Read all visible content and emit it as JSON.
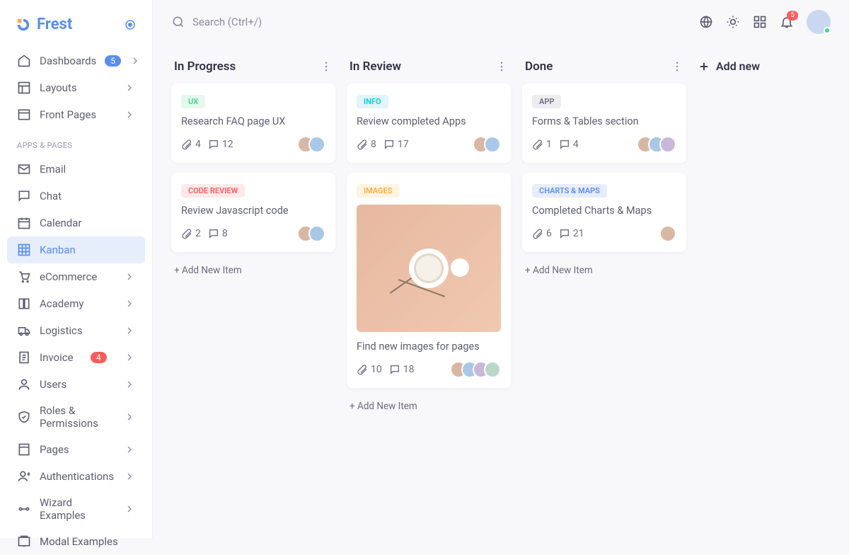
{
  "brand": "Frest",
  "search": {
    "placeholder": "Search (Ctrl+/)"
  },
  "topbar": {
    "bell_count": "5"
  },
  "sidebar": {
    "section_label": "APPS & PAGES",
    "items": [
      {
        "label": "Dashboards",
        "badge": "5",
        "chev": true
      },
      {
        "label": "Layouts",
        "chev": true
      },
      {
        "label": "Front Pages",
        "chev": true
      }
    ],
    "apps": [
      {
        "label": "Email"
      },
      {
        "label": "Chat"
      },
      {
        "label": "Calendar"
      },
      {
        "label": "Kanban",
        "active": true
      },
      {
        "label": "eCommerce",
        "chev": true
      },
      {
        "label": "Academy",
        "chev": true
      },
      {
        "label": "Logistics",
        "chev": true
      },
      {
        "label": "Invoice",
        "badge": "4",
        "badge_red": true,
        "chev": true
      },
      {
        "label": "Users",
        "chev": true
      },
      {
        "label": "Roles & Permissions",
        "chev": true
      },
      {
        "label": "Pages",
        "chev": true
      },
      {
        "label": "Authentications",
        "chev": true
      },
      {
        "label": "Wizard Examples",
        "chev": true
      },
      {
        "label": "Modal Examples"
      }
    ]
  },
  "board": {
    "add_new_label": "Add new",
    "add_item_label": "+ Add New Item",
    "columns": [
      {
        "title": "In Progress",
        "cards": [
          {
            "tag": "UX",
            "tag_class": "tag-ux",
            "title": "Research FAQ page UX",
            "attachments": "4",
            "comments": "12",
            "avatars": 2
          },
          {
            "tag": "CODE REVIEW",
            "tag_class": "tag-code",
            "title": "Review Javascript code",
            "attachments": "2",
            "comments": "8",
            "avatars": 2
          }
        ]
      },
      {
        "title": "In Review",
        "cards": [
          {
            "tag": "INFO",
            "tag_class": "tag-info",
            "title": "Review completed Apps",
            "attachments": "8",
            "comments": "17",
            "avatars": 2
          },
          {
            "tag": "IMAGES",
            "tag_class": "tag-images",
            "title": "Find new images for pages",
            "attachments": "10",
            "comments": "18",
            "avatars": 4,
            "has_image": true
          }
        ]
      },
      {
        "title": "Done",
        "cards": [
          {
            "tag": "APP",
            "tag_class": "tag-app",
            "title": "Forms & Tables section",
            "attachments": "1",
            "comments": "4",
            "avatars": 3
          },
          {
            "tag": "CHARTS & MAPS",
            "tag_class": "tag-charts",
            "title": "Completed Charts & Maps",
            "attachments": "6",
            "comments": "21",
            "avatars": 1
          }
        ]
      }
    ]
  }
}
